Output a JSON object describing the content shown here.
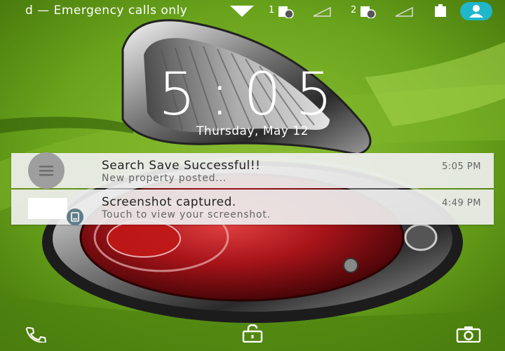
{
  "status_bar": {
    "text": "d — Emergency calls only",
    "sim1_label": "1",
    "sim2_label": "2",
    "icons": [
      "wifi-icon",
      "sim1-icon",
      "signal-icon",
      "sim2-icon",
      "signal-icon",
      "battery-icon",
      "user-icon"
    ]
  },
  "lockscreen": {
    "time": "5:05",
    "date": "Thursday, May 12"
  },
  "notifications": [
    {
      "title": "Search Save Successful!!",
      "body": "New property posted...",
      "time": "5:05 PM",
      "icon": "menu-icon"
    },
    {
      "title": "Screenshot captured.",
      "body": "Touch to view your screenshot.",
      "time": "4:49 PM",
      "icon": "screenshot-icon"
    }
  ],
  "bottom_bar": {
    "icons": [
      "phone-icon",
      "lock-icon",
      "camera-icon"
    ]
  },
  "colors": {
    "wallpaper_green": "#5f9a16",
    "avatar_teal": "#1fb7c9"
  }
}
